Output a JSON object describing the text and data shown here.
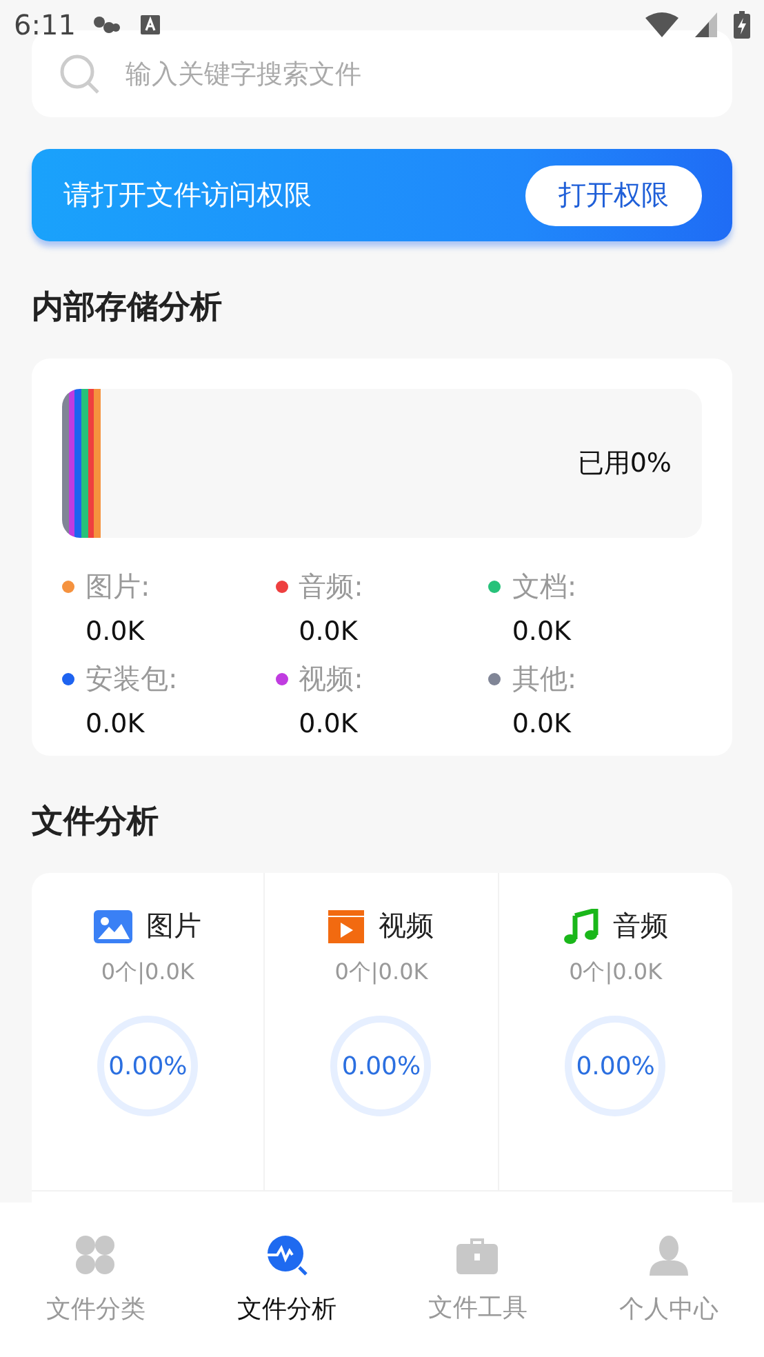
{
  "status_bar": {
    "time": "6:11"
  },
  "search": {
    "placeholder": "输入关键字搜索文件"
  },
  "permission_banner": {
    "message": "请打开文件访问权限",
    "button": "打开权限"
  },
  "storage": {
    "title": "内部存储分析",
    "usage": "已用0%",
    "legend": [
      {
        "label": "图片:",
        "value": "0.0K",
        "color": "#f5923e"
      },
      {
        "label": "音频:",
        "value": "0.0K",
        "color": "#ee3f3f"
      },
      {
        "label": "文档:",
        "value": "0.0K",
        "color": "#27c27a"
      },
      {
        "label": "安装包:",
        "value": "0.0K",
        "color": "#1e63f0"
      },
      {
        "label": "视频:",
        "value": "0.0K",
        "color": "#c03ce0"
      },
      {
        "label": "其他:",
        "value": "0.0K",
        "color": "#808596"
      }
    ]
  },
  "file_analysis": {
    "title": "文件分析",
    "items": [
      {
        "kind": "image",
        "name": "图片",
        "summary": "0个|0.0K",
        "percent": "0.00%"
      },
      {
        "kind": "video",
        "name": "视频",
        "summary": "0个|0.0K",
        "percent": "0.00%"
      },
      {
        "kind": "audio",
        "name": "音频",
        "summary": "0个|0.0K",
        "percent": "0.00%"
      }
    ]
  },
  "bottom_nav": [
    {
      "kind": "category",
      "label": "文件分类",
      "selected": false
    },
    {
      "kind": "analysis",
      "label": "文件分析",
      "selected": true
    },
    {
      "kind": "tools",
      "label": "文件工具",
      "selected": false
    },
    {
      "kind": "profile",
      "label": "个人中心",
      "selected": false
    }
  ]
}
